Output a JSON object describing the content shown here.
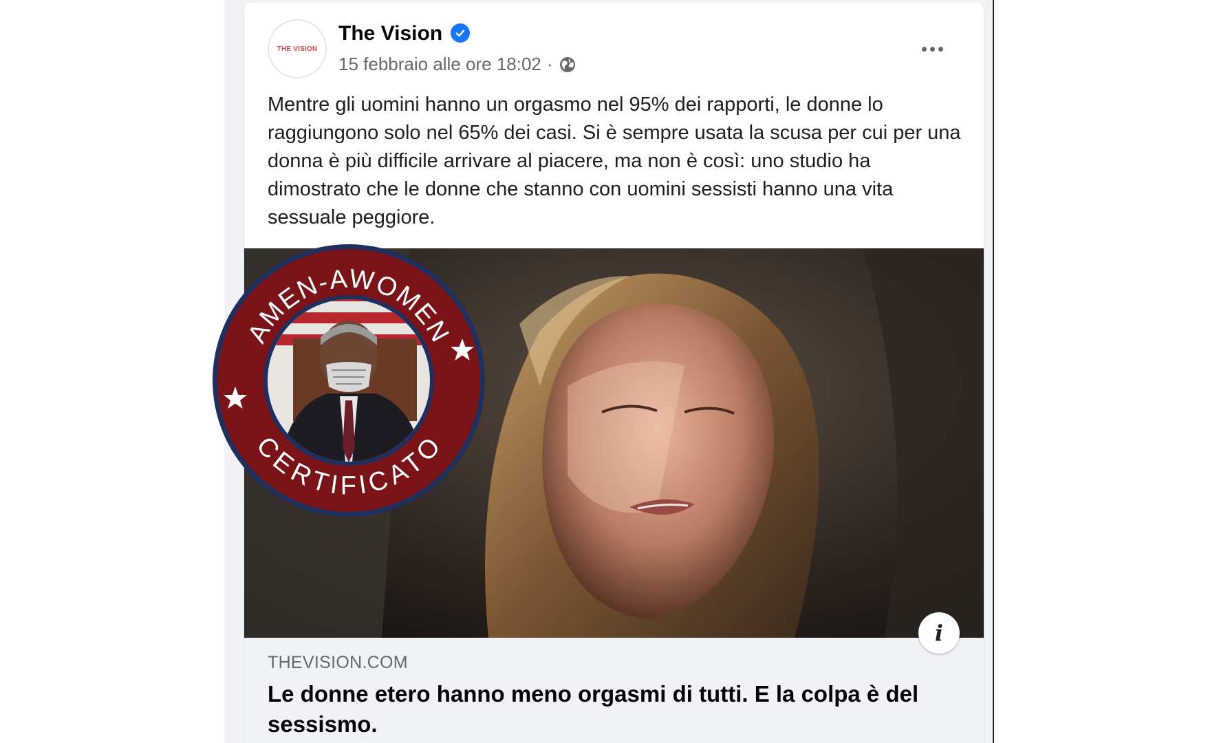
{
  "post": {
    "author": {
      "name": "The Vision",
      "avatar_text": "THE VISION",
      "verified": true
    },
    "timestamp": "15 febbraio alle ore 18:02",
    "separator": "·",
    "audience_icon": "globe-icon",
    "more_icon": "more-horizontal-icon",
    "text": "Mentre gli uomini hanno un orgasmo nel 95% dei rapporti, le donne lo raggiungono solo nel 65% dei casi. Si è sempre usata la scusa per cui per una donna è più difficile arrivare al piacere, ma non è così: uno studio ha dimostrato che le donne che stanno con uomini sessisti hanno una vita sessuale peggiore.",
    "link": {
      "domain": "THEVISION.COM",
      "title": "Le donne etero hanno meno orgasmi di tutti. E la colpa è del sessismo.",
      "info_icon": "info-icon",
      "info_glyph": "i"
    }
  },
  "seal": {
    "top_text": "AMEN-AWOMEN",
    "bottom_text": "CERTIFICATO",
    "ring_color": "#7a1418",
    "border_color": "#1f2f5e"
  },
  "colors": {
    "verified_blue": "#1877f2",
    "feed_bg": "#f0f2f5"
  }
}
